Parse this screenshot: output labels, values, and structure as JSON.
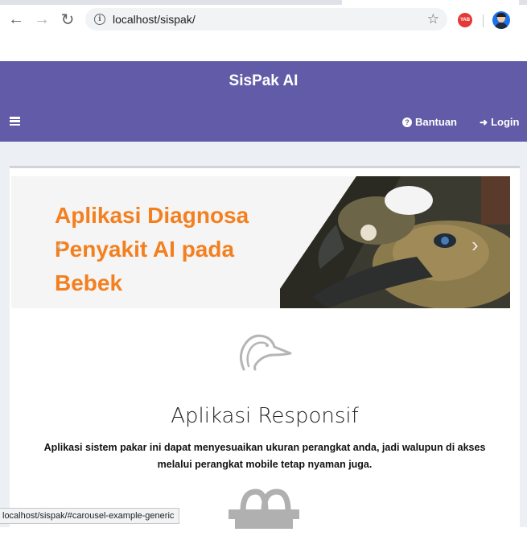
{
  "browser": {
    "url": "localhost/sispak/",
    "extension_label": "YAB",
    "status_url": "localhost/sispak/#carousel-example-generic"
  },
  "header": {
    "title": "SisPak AI",
    "help_label": "Bantuan",
    "login_label": "Login",
    "background_color": "#625ca8"
  },
  "carousel": {
    "banner_lines": [
      "Aplikasi Diagnosa",
      "Penyakit AI pada",
      "Bebek"
    ],
    "banner_color": "#f47f1f",
    "prev_icon": "chevron-left-icon",
    "next_icon": "chevron-right-icon"
  },
  "feature": {
    "icon": "duck-icon",
    "title": "Aplikasi Responsif",
    "description_line1": "Aplikasi sistem pakar ini dapat menyesuaikan ukuran perangkat anda, jadi walupun di akses",
    "description_line2": "melalui perangkat mobile tetap nyaman juga.",
    "next_icon": "basket-icon"
  }
}
